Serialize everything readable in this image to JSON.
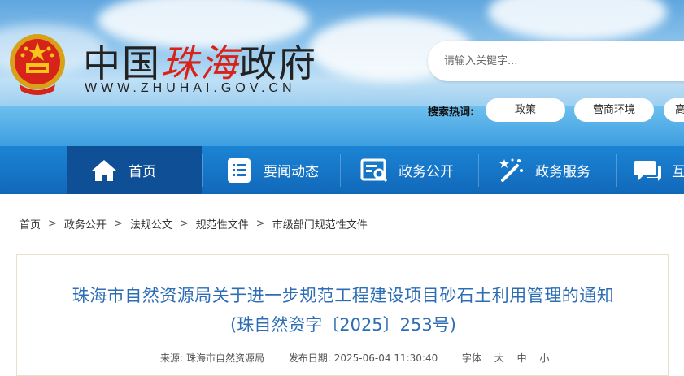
{
  "header": {
    "site_name_pre": "中国",
    "site_name_red": "珠海",
    "site_name_post": "政府",
    "site_url": "WWW.ZHUHAI.GOV.CN",
    "search_placeholder": "请输入关键字...",
    "hot_label": "搜索热词:",
    "hot_tags": [
      "政策",
      "营商环境",
      "高"
    ]
  },
  "nav": {
    "items": [
      {
        "label": "首页",
        "icon": "home-icon"
      },
      {
        "label": "要闻动态",
        "icon": "list-icon"
      },
      {
        "label": "政务公开",
        "icon": "document-search-icon"
      },
      {
        "label": "政务服务",
        "icon": "magic-wand-icon"
      },
      {
        "label": "互",
        "icon": "chat-icon"
      }
    ]
  },
  "breadcrumb": [
    "首页",
    "政务公开",
    "法规公文",
    "规范性文件",
    "市级部门规范性文件"
  ],
  "breadcrumb_separator": ">",
  "article": {
    "title_line1": "珠海市自然资源局关于进一步规范工程建设项目砂石土利用管理的通知",
    "title_line2": "(珠自然资字〔2025〕253号)",
    "source_label": "来源:",
    "source": "珠海市自然资源局",
    "date_label": "发布日期:",
    "date": "2025-06-04 11:30:40",
    "font_label": "字体",
    "font_sizes": [
      "大",
      "中",
      "小"
    ]
  },
  "colors": {
    "nav_bg": "#1672c4",
    "nav_active": "#0e4f96",
    "title": "#2c6db5",
    "red": "#d8231a"
  }
}
